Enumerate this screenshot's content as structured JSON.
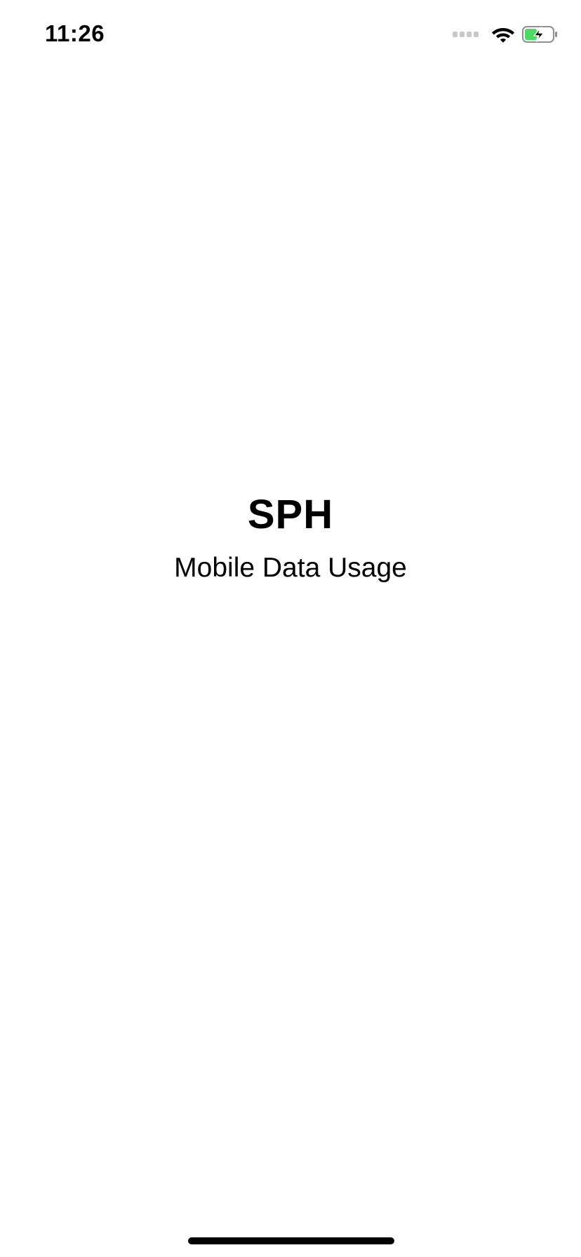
{
  "status_bar": {
    "time": "11:26",
    "icons": [
      "cellular-signal-icon",
      "wifi-icon",
      "battery-charging-icon"
    ],
    "battery_color": "#4cd964"
  },
  "splash": {
    "title": "SPH",
    "subtitle": "Mobile Data Usage"
  },
  "colors": {
    "background": "#ffffff",
    "text": "#000000"
  }
}
